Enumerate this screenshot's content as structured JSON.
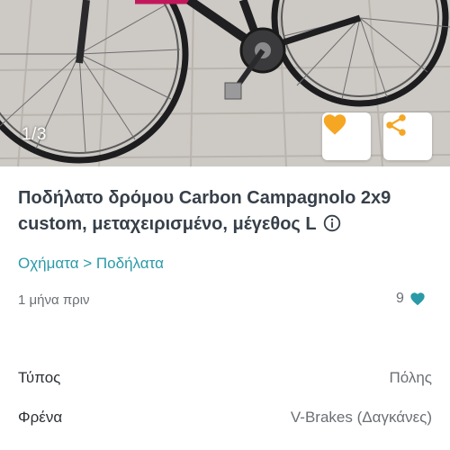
{
  "photo": {
    "counter": "1/3",
    "favorite_icon": "heart-icon",
    "share_icon": "share-icon",
    "accent_color": "#f5a623"
  },
  "listing": {
    "title": "Ποδήλατο δρόμου Carbon Campagnolo 2x9 custom, μεταχειρισμένο, μέγεθος L",
    "info_icon": "info-icon",
    "category_path": "Οχήματα > Ποδήλατα",
    "posted": "1 μήνα πριν",
    "favorites_count": "9",
    "favorites_icon": "heart-icon",
    "link_color": "#2a9aa8"
  },
  "specs": [
    {
      "label": "Τύπος",
      "value": "Πόλης"
    },
    {
      "label": "Φρένα",
      "value": "V-Brakes (Δαγκάνες)"
    },
    {
      "label": "",
      "value": ""
    }
  ]
}
